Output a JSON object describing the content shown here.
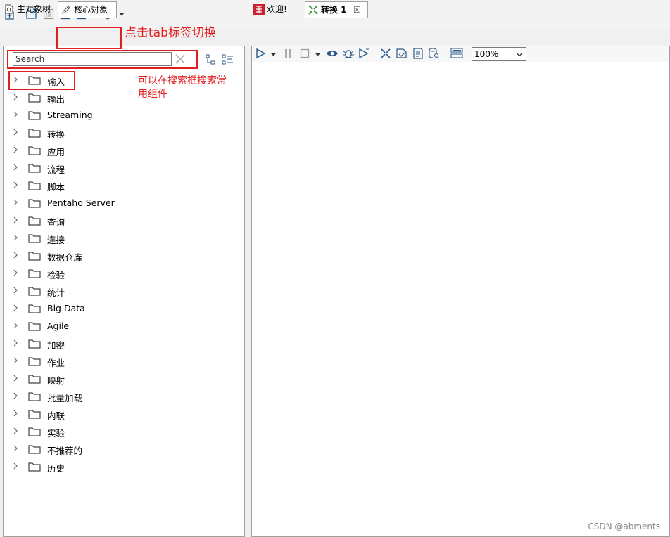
{
  "left_panel": {
    "tabs": [
      {
        "label": "主对象树",
        "icon": "document-search-icon"
      },
      {
        "label": "核心对象",
        "icon": "pencil-icon"
      }
    ],
    "search": {
      "placeholder": "Search"
    },
    "tree_items": [
      {
        "label": "输入"
      },
      {
        "label": "输出"
      },
      {
        "label": "Streaming"
      },
      {
        "label": "转换"
      },
      {
        "label": "应用"
      },
      {
        "label": "流程"
      },
      {
        "label": "脚本"
      },
      {
        "label": "Pentaho Server"
      },
      {
        "label": "查询"
      },
      {
        "label": "连接"
      },
      {
        "label": "数据仓库"
      },
      {
        "label": "检验"
      },
      {
        "label": "统计"
      },
      {
        "label": "Big Data"
      },
      {
        "label": "Agile"
      },
      {
        "label": "加密"
      },
      {
        "label": "作业"
      },
      {
        "label": "映射"
      },
      {
        "label": "批量加载"
      },
      {
        "label": "内联"
      },
      {
        "label": "实验"
      },
      {
        "label": "不推荐的"
      },
      {
        "label": "历史"
      }
    ]
  },
  "annotations": {
    "tab_hint": "点击tab标签切换",
    "search_hint_line1": "可以在搜索框搜索常",
    "search_hint_line2": "用组件",
    "color": "#e02020"
  },
  "right_panel": {
    "tabs": [
      {
        "label": "欢迎!",
        "icon": "spoon-logo-icon"
      },
      {
        "label": "转换 1",
        "icon": "transformation-icon",
        "close": "☒"
      }
    ],
    "zoom": "100%"
  },
  "watermark": "CSDN @abments"
}
